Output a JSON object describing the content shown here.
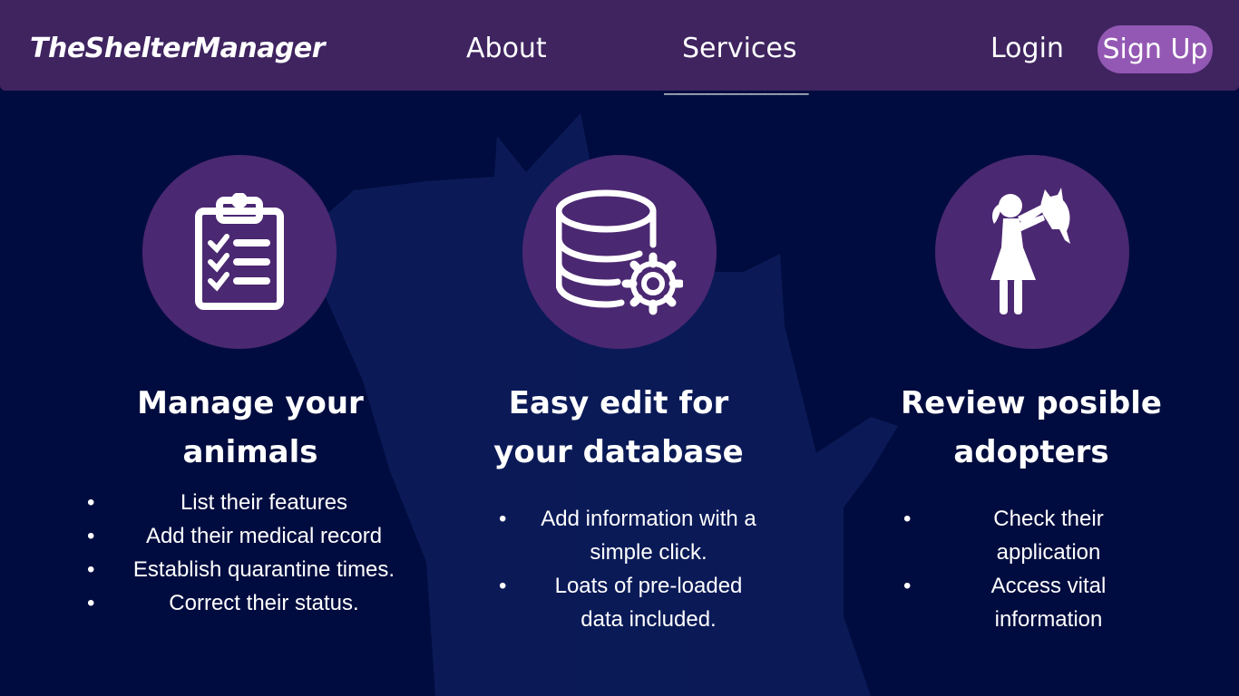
{
  "nav": {
    "brand": "TheShelterManager",
    "about": "About",
    "services": "Services",
    "services_underline": "__________",
    "login": "Login",
    "signup": "Sign Up"
  },
  "features": [
    {
      "icon": "clipboard-checklist-icon",
      "title_line1": "Manage your",
      "title_line2": "animals",
      "items": [
        "List their features",
        "Add their medical record",
        "Establish quarantine times.",
        "Correct their status."
      ]
    },
    {
      "icon": "database-gear-icon",
      "title_line1": "Easy edit for",
      "title_line2": "your database",
      "items": [
        "Add information with a simple click.",
        "Loats of pre-loaded data included."
      ]
    },
    {
      "icon": "person-lifting-cat-icon",
      "title_line1": "Review posible",
      "title_line2": "adopters",
      "items": [
        "Check their application",
        "Access vital information"
      ]
    }
  ],
  "colors": {
    "background": "#000c3f",
    "navbar": "#3f2460",
    "icon_circle": "#4b2872",
    "signup_button": "#9358b3",
    "silhouette": "#0d1e5c"
  }
}
